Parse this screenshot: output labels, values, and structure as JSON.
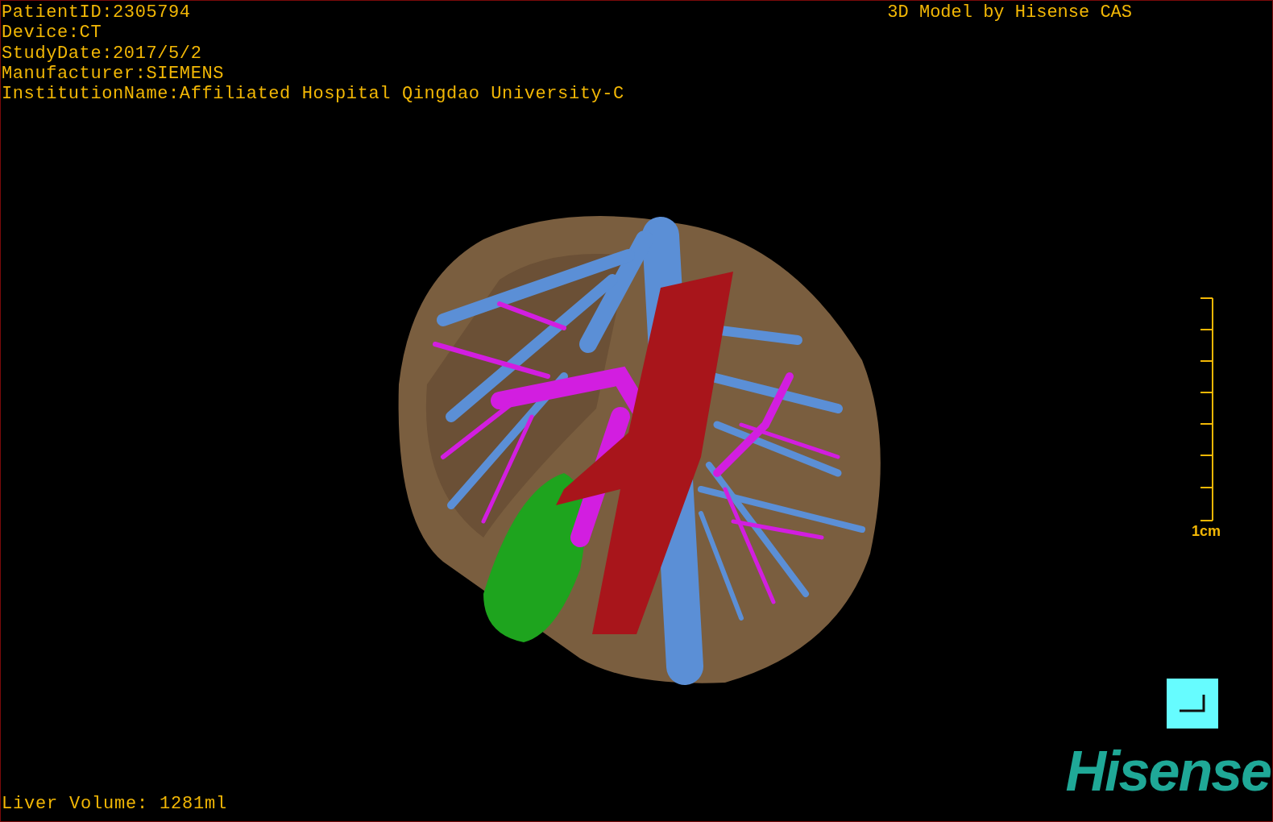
{
  "patient_info": [
    "PatientID:2305794",
    "Device:CT",
    "StudyDate:2017/5/2",
    "Manufacturer:SIEMENS",
    "InstitutionName:Affiliated Hospital Qingdao University-C"
  ],
  "title": "3D Model by Hisense CAS",
  "scale_bar": {
    "label": "1cm"
  },
  "liver_volume": "Liver Volume: 1281ml",
  "logo": "Hisense"
}
